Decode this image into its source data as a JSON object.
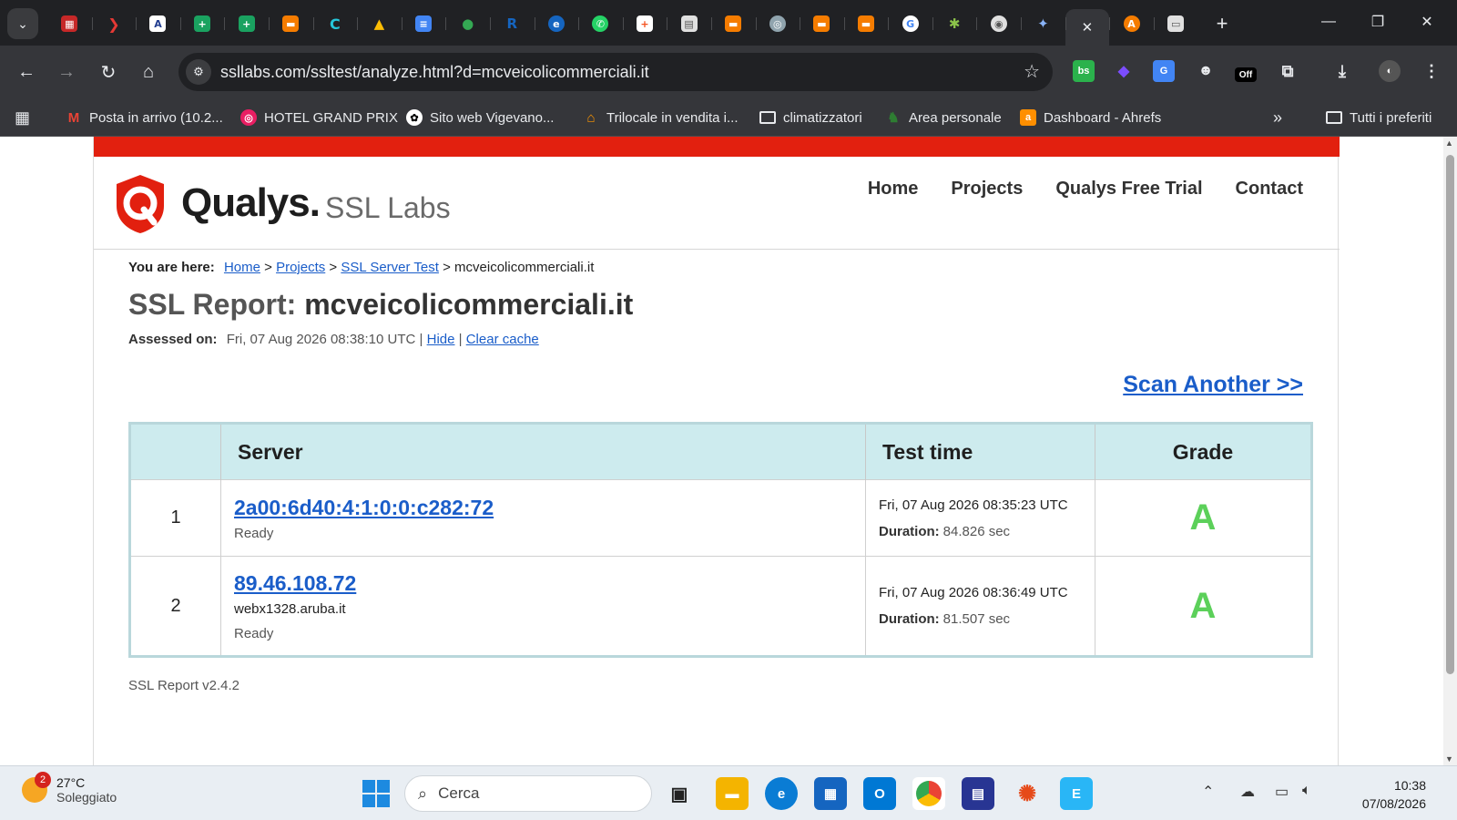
{
  "browser": {
    "url": "ssllabs.com/ssltest/analyze.html?d=mcveicolicommerciali.it",
    "bookmarks": [
      {
        "label": "Posta in arrivo (10.2...",
        "icon": "gmail-icon"
      },
      {
        "label": "HOTEL GRAND PRIX",
        "icon": "hotel-icon"
      },
      {
        "label": "Sito web Vigevano...",
        "icon": "openai-icon"
      },
      {
        "label": "Trilocale in vendita i...",
        "icon": "house-icon"
      },
      {
        "label": "climatizzatori",
        "icon": "folder-icon"
      },
      {
        "label": "Area personale",
        "icon": "area-icon"
      },
      {
        "label": "Dashboard - Ahrefs",
        "icon": "ahrefs-icon"
      }
    ],
    "all_bookmarks": "Tutti i preferiti",
    "extension_off_label": "Off"
  },
  "site": {
    "brand": "Qualys.",
    "brand_sub": "SSL Labs",
    "nav": [
      "Home",
      "Projects",
      "Qualys Free Trial",
      "Contact"
    ]
  },
  "breadcrumb": {
    "label": "You are here:",
    "home": "Home",
    "projects": "Projects",
    "ssl_server_test": "SSL Server Test",
    "current": "mcveicolicommerciali.it",
    "sep": ">"
  },
  "report": {
    "title_prefix": "SSL Report:",
    "domain": "mcveicolicommerciali.it",
    "assessed_label": "Assessed on:",
    "assessed_value": "Fri, 07 Aug 2026 08:38:10 UTC",
    "hide": "Hide",
    "clear_cache": "Clear cache",
    "scan_another": "Scan Another >>",
    "version": "SSL Report v2.4.2"
  },
  "table": {
    "headers": [
      "",
      "Server",
      "Test time",
      "Grade"
    ],
    "rows": [
      {
        "num": "1",
        "server": "2a00:6d40:4:1:0:0:c282:72",
        "host": "",
        "status": "Ready",
        "time": "Fri, 07 Aug 2026 08:35:23 UTC",
        "duration_label": "Duration:",
        "duration": "84.826 sec",
        "grade": "A"
      },
      {
        "num": "2",
        "server": "89.46.108.72",
        "host": "webx1328.aruba.it",
        "status": "Ready",
        "time": "Fri, 07 Aug 2026 08:36:49 UTC",
        "duration_label": "Duration:",
        "duration": "81.507 sec",
        "grade": "A"
      }
    ]
  },
  "taskbar": {
    "weather_temp": "27°C",
    "weather_desc": "Soleggiato",
    "weather_badge": "2",
    "search_placeholder": "Cerca",
    "time": "10:38",
    "date": "07/08/2026"
  },
  "colors": {
    "brand_red": "#e2200f",
    "link_blue": "#1a5dc9",
    "grade_green": "#5cd05a",
    "table_header": "#cdebee"
  }
}
